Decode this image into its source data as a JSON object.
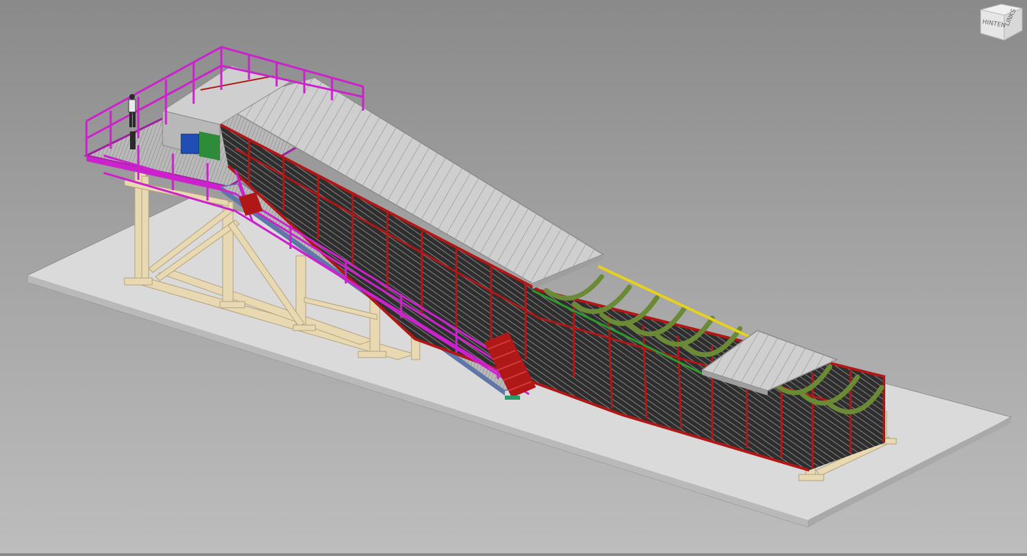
{
  "viewcube": {
    "face_back": "HINTEN",
    "face_left": "LINKS"
  },
  "colors": {
    "background_top": "#8a8a8a",
    "background_bottom": "#bdbdbd",
    "ground_plate": "#d7d7d7",
    "support_structure": "#e6d6b0",
    "handrail": "#cc22cc",
    "conveyor_frame": "#b01818",
    "mesh_panel": "#333333",
    "roof": "#c9c9c9",
    "idlers": "#6b8a35"
  },
  "icons": {
    "viewcube": "viewcube-icon"
  }
}
